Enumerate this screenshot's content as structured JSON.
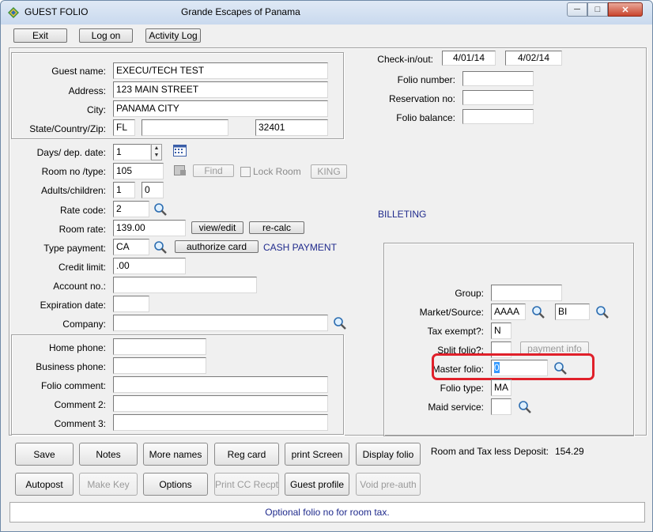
{
  "window": {
    "title": "GUEST FOLIO",
    "company": "Grande Escapes of Panama"
  },
  "toolbar": {
    "exit": "Exit",
    "logon": "Log on",
    "activity_log": "Activity Log"
  },
  "guest": {
    "name_label": "Guest name:",
    "name": "EXECU/TECH TEST",
    "address_label": "Address:",
    "address": "123 MAIN STREET",
    "city_label": "City:",
    "city": "PANAMA CITY",
    "state_label": "State/Country/Zip:",
    "state": "FL",
    "country": "",
    "zip": "32401"
  },
  "stay": {
    "days_label": "Days/ dep. date:",
    "days": "1",
    "room_label": "Room no /type:",
    "room_no": "105",
    "find": "Find",
    "lock_room": "Lock Room",
    "room_type": "KING",
    "adults_label": "Adults/children:",
    "adults": "1",
    "children": "0",
    "rate_code_label": "Rate code:",
    "rate_code": "2",
    "room_rate_label": "Room rate:",
    "room_rate": "139.00",
    "view_edit": "view/edit",
    "recalc": "re-calc",
    "type_payment_label": "Type payment:",
    "type_payment": "CA",
    "authorize_card": "authorize card",
    "payment_desc": "CASH PAYMENT",
    "credit_limit_label": "Credit limit:",
    "credit_limit": ".00",
    "account_label": "Account no.:",
    "account": "",
    "expiration_label": "Expiration date:",
    "expiration": "",
    "company_label": "Company:",
    "company": ""
  },
  "contact": {
    "home_phone_label": "Home phone:",
    "business_phone_label": "Business phone:",
    "folio_comment_label": "Folio comment:",
    "comment2_label": "Comment 2:",
    "comment3_label": "Comment 3:"
  },
  "folio": {
    "checkin_label": "Check-in/out:",
    "checkin": "4/01/14",
    "checkout": "4/02/14",
    "folio_number_label": "Folio number:",
    "reservation_label": "Reservation no:",
    "balance_label": "Folio balance:",
    "billeting": "BILLETING"
  },
  "billing": {
    "group_label": "Group:",
    "group": "",
    "market_label": "Market/Source:",
    "market": "AAAA",
    "source": "BI",
    "tax_exempt_label": "Tax exempt?:",
    "tax_exempt": "N",
    "split_label": "Split folio?:",
    "split": "",
    "payment_info": "payment info",
    "master_label": "Master folio:",
    "master": "0",
    "folio_type_label": "Folio type:",
    "folio_type": "MA",
    "maid_label": "Maid service:",
    "maid": ""
  },
  "summary": {
    "label": "Room and Tax less Deposit:",
    "value": "154.29"
  },
  "actions": {
    "save": "Save",
    "notes": "Notes",
    "more_names": "More names",
    "reg_card": "Reg card",
    "print_screen": "print Screen",
    "display_folio": "Display folio",
    "autopost": "Autopost",
    "make_key": "Make Key",
    "options": "Options",
    "print_cc": "Print CC Recpt",
    "guest_profile": "Guest profile",
    "void_preauth": "Void pre-auth"
  },
  "status": "Optional folio no for room  tax.",
  "colors": {
    "highlight": "#e0202a",
    "status_text": "#1f2a8c"
  }
}
